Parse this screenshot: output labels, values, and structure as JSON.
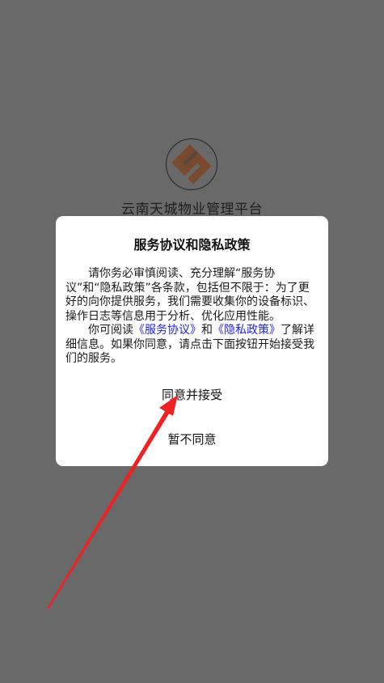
{
  "splash": {
    "app_name": "云南天城物业管理平台",
    "logo_icon": "company-logo-icon",
    "logo_color": "#7a4a2e"
  },
  "dialog": {
    "title": "服务协议和隐私政策",
    "para1": "请你务必审慎阅读、充分理解“服务协议”和“隐私政策”各条款，包括但不限于：为了更好的向你提供服务，我们需要收集你的设备标识、操作日志等信息用于分析、优化应用性能。",
    "para2_before": "你可阅读",
    "link_service": "《服务协议》",
    "para2_and": "和",
    "link_privacy": "《隐私政策》",
    "para2_after": "了解详细信息。如果你同意，请点击下面按钮开始接受我们的服务。",
    "accept_label": "同意并接受",
    "decline_label": "暂不同意",
    "link_color": "#2222dd"
  },
  "annotation": {
    "arrow_color": "#ee2222"
  }
}
